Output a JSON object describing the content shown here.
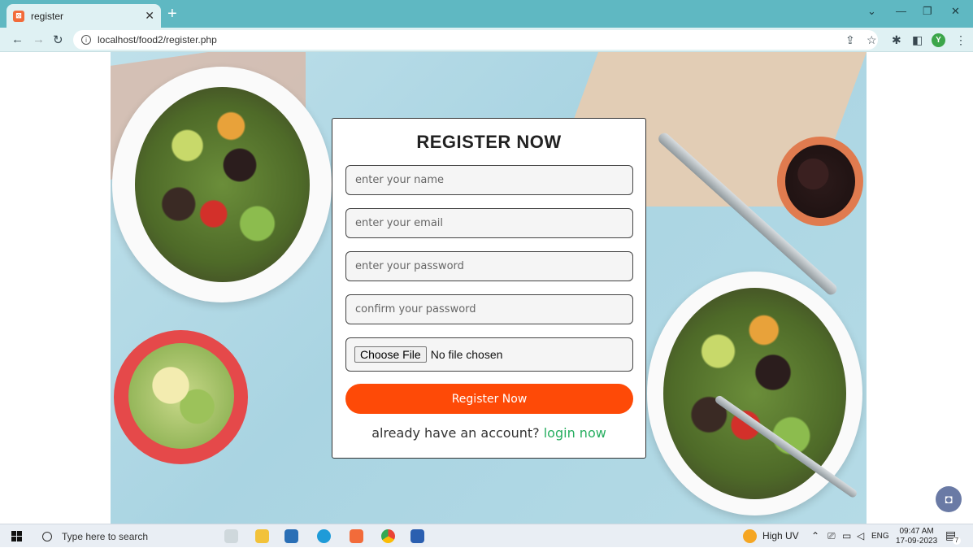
{
  "browser": {
    "tab_title": "register",
    "tab_favicon": "xampp-icon",
    "url": "localhost/food2/register.php",
    "profile_initial": "Y"
  },
  "form": {
    "title": "REGISTER NOW",
    "name_placeholder": "enter your name",
    "email_placeholder": "enter your email",
    "password_placeholder": "enter your password",
    "confirm_placeholder": "confirm your password",
    "file_button": "Choose File",
    "file_status": "No file chosen",
    "submit_label": "Register Now",
    "login_prompt": "already have an account?",
    "login_link": "login now"
  },
  "taskbar": {
    "search_placeholder": "Type here to search",
    "weather": "High UV",
    "language": "ENG",
    "time": "09:47 AM",
    "date": "17-09-2023",
    "notification_count": "7"
  },
  "colors": {
    "accent": "#fe4a07",
    "link": "#27ae60",
    "tabbar": "#5fb8c2"
  }
}
